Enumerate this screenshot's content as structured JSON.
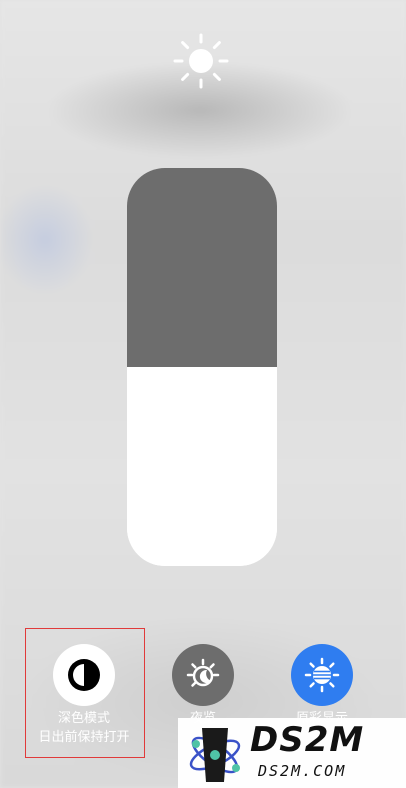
{
  "brightness": {
    "level_percent": 50,
    "icon": "sun-icon"
  },
  "toggles": [
    {
      "id": "dark-mode",
      "label": "深色模式",
      "sublabel": "日出前保持打开",
      "icon": "dark-mode-icon",
      "active": true,
      "color": "#ffffff"
    },
    {
      "id": "night-shift",
      "label": "夜览",
      "icon": "night-shift-icon",
      "active": false,
      "color": "#6d6d6d"
    },
    {
      "id": "true-color",
      "label": "原彩显示",
      "icon": "true-color-icon",
      "active": true,
      "color": "#2f7df0"
    }
  ],
  "watermark": {
    "title": "DS2M",
    "subtitle": "DS2M.COM"
  }
}
